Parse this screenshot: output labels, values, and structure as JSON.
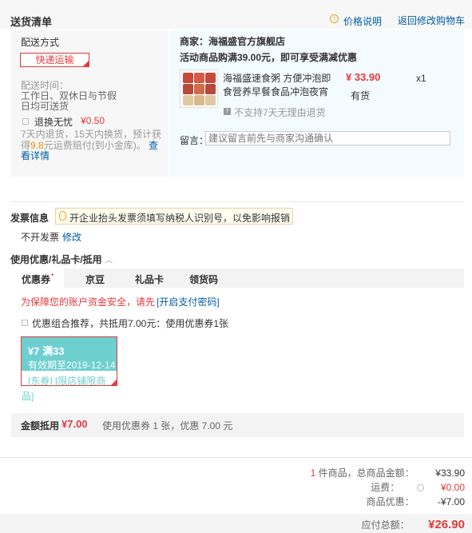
{
  "delivery": {
    "title": "送货清单",
    "price_note": "价格说明",
    "back_to_cart": "返回修改购物车"
  },
  "shipping": {
    "method_label": "配送方式",
    "method_value": "快递运输",
    "time_label": "配送时间：",
    "time_value_1": "工作日、双休日与节假",
    "time_value_2": "日均可送货",
    "return_label": "退换无忧",
    "return_price": "¥0.50",
    "return_desc_1": "7天内退货，15天内换货，预计获",
    "return_desc_2a": "得",
    "return_desc_amount": "9.8",
    "return_desc_2b": "元运费赔付(到小金库)。",
    "see_detail_1": "查",
    "see_detail_2": "看详情"
  },
  "shop": {
    "merchant": "商家：海福盛官方旗舰店",
    "promo": "活动商品购满39.00元，即可享受满减优惠",
    "product_name_1": "海福盛速食粥 方便冲泡即",
    "product_name_2": "食营养早餐食品冲泡夜宵",
    "price": "¥ 33.90",
    "qty": "x1",
    "stock": "有货",
    "no_return": "不支持7天无理由退货",
    "note_label": "留言：",
    "note_placeholder": "建议留言前先与商家沟通确认"
  },
  "invoice": {
    "title": "发票信息",
    "tip": "开企业抬头发票须填写纳税人识别号，以免影响报销",
    "value": "不开发票",
    "edit": "修改"
  },
  "coupons": {
    "title": "使用优惠/礼品卡/抵用",
    "tabs": [
      "优惠券",
      "京豆",
      "礼品卡",
      "领货码"
    ],
    "tab_star": "•",
    "security_msg": "为保障您的账户资金安全，请先",
    "security_link": "[开启支付密码]",
    "combo_text": "优惠组合推荐，共抵用7.00元：使用优惠券1张",
    "card_amount": "¥7 满33",
    "card_expire": "有效期至2019-12-14",
    "card_tag_1": "[东券] [限店铺限商",
    "card_tag_2": "品]",
    "sum_label": "金额抵用",
    "sum_amount": "¥7.00",
    "sum_desc": "使用优惠券 1 张，优惠 7.00 元"
  },
  "summary": {
    "count": "1",
    "count_suffix": "件商品，总商品金额：",
    "goods_total": "¥33.90",
    "freight_label": "运费：",
    "freight_value": "¥0.00",
    "discount_label": "商品优惠：",
    "discount_value": "-¥7.00",
    "payable_label": "应付总额：",
    "payable_value": "¥26.90"
  },
  "colors": {
    "accent_red": "#e4393c",
    "link_blue": "#005ea7",
    "coupon_teal": "#6ecfcf"
  }
}
